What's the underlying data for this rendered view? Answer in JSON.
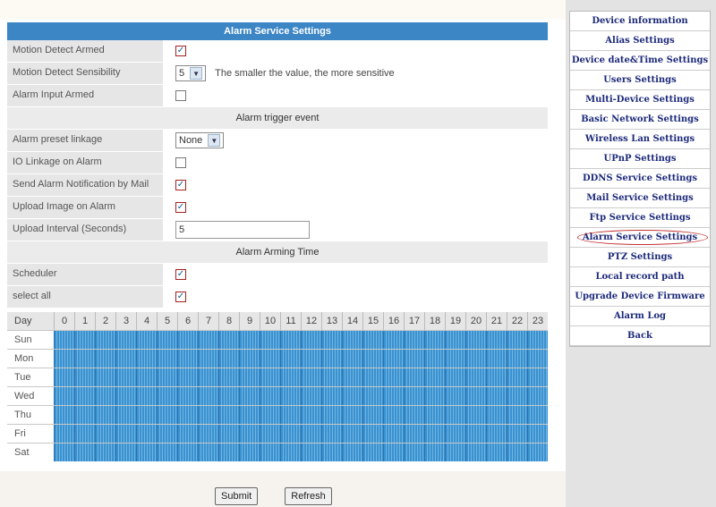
{
  "form": {
    "title": "Alarm Service Settings",
    "motion_detect_armed": {
      "label": "Motion Detect Armed",
      "checked": true
    },
    "motion_detect_sensibility": {
      "label": "Motion Detect Sensibility",
      "value": "5",
      "hint": "The smaller the value, the more sensitive"
    },
    "alarm_input_armed": {
      "label": "Alarm Input Armed",
      "checked": false
    },
    "trigger_section": "Alarm trigger event",
    "alarm_preset_linkage": {
      "label": "Alarm preset linkage",
      "value": "None"
    },
    "io_linkage": {
      "label": "IO Linkage on Alarm",
      "checked": false
    },
    "send_mail": {
      "label": "Send Alarm Notification by Mail",
      "checked": true
    },
    "upload_image": {
      "label": "Upload Image on Alarm",
      "checked": true
    },
    "upload_interval": {
      "label": "Upload Interval (Seconds)",
      "value": "5"
    },
    "arming_section": "Alarm Arming Time",
    "scheduler": {
      "label": "Scheduler",
      "checked": true
    },
    "select_all": {
      "label": "select all",
      "checked": true
    }
  },
  "schedule": {
    "day_header": "Day",
    "hours": [
      "0",
      "1",
      "2",
      "3",
      "4",
      "5",
      "6",
      "7",
      "8",
      "9",
      "10",
      "11",
      "12",
      "13",
      "14",
      "15",
      "16",
      "17",
      "18",
      "19",
      "20",
      "21",
      "22",
      "23"
    ],
    "days": [
      "Sun",
      "Mon",
      "Tue",
      "Wed",
      "Thu",
      "Fri",
      "Sat"
    ],
    "all_selected": true
  },
  "buttons": {
    "submit": "Submit",
    "refresh": "Refresh"
  },
  "sidebar": {
    "items": [
      "Device information",
      "Alias Settings",
      "Device date&Time Settings",
      "Users Settings",
      "Multi-Device Settings",
      "Basic Network Settings",
      "Wireless Lan Settings",
      "UPnP Settings",
      "DDNS Service Settings",
      "Mail Service Settings",
      "Ftp Service Settings",
      "Alarm Service Settings",
      "PTZ Settings",
      "Local record path",
      "Upgrade Device Firmware",
      "Alarm Log",
      "Back"
    ],
    "active_index": 11
  },
  "colors": {
    "accent": "#3d86c6",
    "schedule_fill": "#3a91cf",
    "nav_text": "#1d2a7a"
  }
}
